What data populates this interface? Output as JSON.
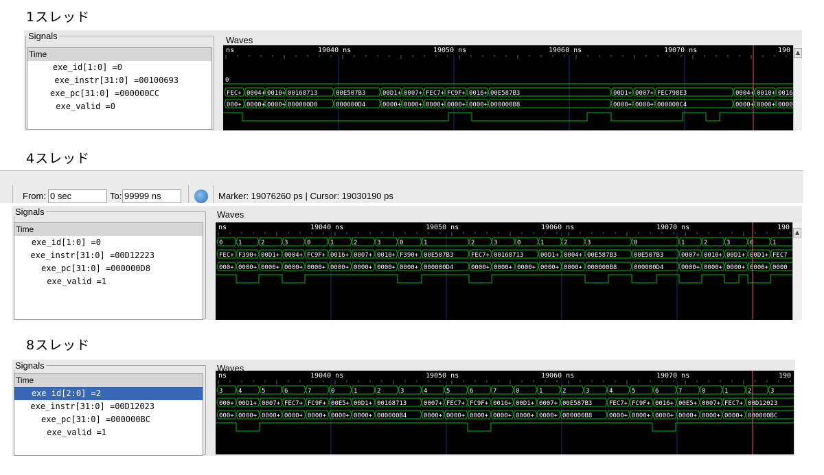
{
  "sections": [
    {
      "title": "1スレッド"
    },
    {
      "title": "4スレッド"
    },
    {
      "title": "8スレッド"
    }
  ],
  "labels": {
    "signals": "Signals",
    "waves": "Waves",
    "time": "Time",
    "ns": "ns"
  },
  "toolbar": {
    "from_label": "From:",
    "from_value": "0 sec",
    "to_label": "To:",
    "to_value": "99999 ns",
    "status": "Marker: 19076260 ps  |  Cursor: 19030190 ps"
  },
  "timeline": {
    "t1": "19040 ns",
    "t2": "19050 ns",
    "t3": "19060 ns",
    "t4": "19070 ns",
    "t5": "190"
  },
  "p1": {
    "signals": [
      "exe_id[1:0] =0",
      "exe_instr[31:0] =00100693",
      "exe_pc[31:0] =000000CC",
      "exe_valid =0"
    ],
    "id_row": "0",
    "instr_row": [
      [
        "FEC+",
        2
      ],
      [
        "0004+",
        31
      ],
      [
        "0010+",
        61
      ],
      [
        "00168713",
        91
      ],
      [
        "00E507B3",
        161
      ],
      [
        "00D1+",
        229
      ],
      [
        "0007+",
        260
      ],
      [
        "FEC7+",
        292
      ],
      [
        "FC9F+",
        323
      ],
      [
        "0016+",
        355
      ],
      [
        "00E587B3",
        386
      ],
      [
        "00D1+",
        565
      ],
      [
        "0007+",
        597
      ],
      [
        "FEC798E3",
        629
      ],
      [
        "0004+",
        743
      ],
      [
        "0010+",
        774
      ],
      [
        "0016",
        805
      ]
    ],
    "pc_row": [
      [
        "000+",
        2
      ],
      [
        "0000+",
        31
      ],
      [
        "0000+",
        61
      ],
      [
        "000000D0",
        91
      ],
      [
        "000000D4",
        161
      ],
      [
        "0000+",
        229
      ],
      [
        "0000+",
        260
      ],
      [
        "0000+",
        292
      ],
      [
        "0000+",
        323
      ],
      [
        "0000+",
        355
      ],
      [
        "000000B8",
        386
      ],
      [
        "0000+",
        565
      ],
      [
        "0000+",
        597
      ],
      [
        "000000C4",
        629
      ],
      [
        "0000+",
        743
      ],
      [
        "0000+",
        774
      ],
      [
        "0000",
        805
      ]
    ]
  },
  "p4": {
    "signals": [
      "exe_id[1:0] =0",
      "exe_instr[31:0] =00D12223",
      "exe_pc[31:0] =000000D8",
      "exe_valid =1"
    ],
    "id_row": [
      [
        "0",
        2
      ],
      [
        "1",
        30
      ],
      [
        "2",
        63
      ],
      [
        "3",
        97
      ],
      [
        "0",
        130
      ],
      [
        "1",
        164
      ],
      [
        "2",
        198
      ],
      [
        "3",
        232
      ],
      [
        "0",
        265
      ],
      [
        "1",
        300
      ],
      [
        "2",
        369
      ],
      [
        "3",
        402
      ],
      [
        "0",
        436
      ],
      [
        "1",
        470
      ],
      [
        "2",
        504
      ],
      [
        "3",
        538
      ],
      [
        "0",
        606
      ],
      [
        "1",
        675
      ],
      [
        "2",
        708
      ],
      [
        "3",
        741
      ],
      [
        "0",
        775
      ],
      [
        "1",
        808
      ]
    ],
    "instr_row": [
      [
        "FEC+",
        2
      ],
      [
        "F390+",
        30
      ],
      [
        "00D1+",
        63
      ],
      [
        "0004+",
        97
      ],
      [
        "FC9F+",
        130
      ],
      [
        "0016+",
        164
      ],
      [
        "0007+",
        198
      ],
      [
        "0010+",
        232
      ],
      [
        "F390+",
        265
      ],
      [
        "00E507B3",
        300
      ],
      [
        "FEC7+",
        369
      ],
      [
        "00168713",
        402
      ],
      [
        "00D1+",
        470
      ],
      [
        "0004+",
        504
      ],
      [
        "00E587B3",
        538
      ],
      [
        "00E507B3",
        606
      ],
      [
        "0007+",
        675
      ],
      [
        "0010+",
        708
      ],
      [
        "00D1+",
        741
      ],
      [
        "00D1+",
        775
      ],
      [
        "FEC7",
        808
      ]
    ],
    "pc_row": [
      [
        "000+",
        2
      ],
      [
        "0000+",
        30
      ],
      [
        "0000+",
        63
      ],
      [
        "0000+",
        97
      ],
      [
        "0000+",
        130
      ],
      [
        "0000+",
        164
      ],
      [
        "0000+",
        198
      ],
      [
        "0000+",
        232
      ],
      [
        "0000+",
        265
      ],
      [
        "000000D4",
        300
      ],
      [
        "0000+",
        369
      ],
      [
        "0000+",
        402
      ],
      [
        "0000+",
        436
      ],
      [
        "0000+",
        470
      ],
      [
        "0000+",
        504
      ],
      [
        "000000B8",
        538
      ],
      [
        "000000D4",
        606
      ],
      [
        "0000+",
        675
      ],
      [
        "0000+",
        708
      ],
      [
        "0000+",
        741
      ],
      [
        "0000+",
        775
      ],
      [
        "0000",
        808
      ]
    ]
  },
  "p8": {
    "signals": [
      "exe id[2:0] =2",
      "exe_instr[31:0] =00D12023",
      "exe_pc[31:0] =000000BC",
      "exe_valid =1"
    ],
    "id_row": [
      [
        "3",
        2
      ],
      [
        "4",
        30
      ],
      [
        "5",
        64
      ],
      [
        "6",
        97
      ],
      [
        "7",
        131
      ],
      [
        "0",
        165
      ],
      [
        "1",
        198
      ],
      [
        "2",
        232
      ],
      [
        "3",
        266
      ],
      [
        "4",
        300
      ],
      [
        "5",
        333
      ],
      [
        "6",
        367
      ],
      [
        "7",
        401
      ],
      [
        "0",
        434
      ],
      [
        "1",
        468
      ],
      [
        "2",
        502
      ],
      [
        "3",
        536
      ],
      [
        "4",
        570
      ],
      [
        "5",
        603
      ],
      [
        "6",
        637
      ],
      [
        "7",
        671
      ],
      [
        "0",
        705
      ],
      [
        "1",
        738
      ],
      [
        "2",
        772
      ],
      [
        "3",
        805
      ]
    ],
    "instr_row": [
      [
        "000+",
        2
      ],
      [
        "00D1+",
        30
      ],
      [
        "0007+",
        64
      ],
      [
        "FEC7+",
        97
      ],
      [
        "FC9F+",
        131
      ],
      [
        "00E5+",
        165
      ],
      [
        "00D1+",
        198
      ],
      [
        "00168713",
        232
      ],
      [
        "0007+",
        300
      ],
      [
        "FEC7+",
        333
      ],
      [
        "FC9F+",
        367
      ],
      [
        "0016+",
        401
      ],
      [
        "00D1+",
        434
      ],
      [
        "0007+",
        468
      ],
      [
        "00E587B3",
        502
      ],
      [
        "FEC7+",
        570
      ],
      [
        "FC9F+",
        603
      ],
      [
        "0016+",
        637
      ],
      [
        "00E5+",
        671
      ],
      [
        "0007+",
        705
      ],
      [
        "FEC7+",
        738
      ],
      [
        "00D12023",
        772
      ]
    ],
    "pc_row": [
      [
        "000+",
        2
      ],
      [
        "0000+",
        30
      ],
      [
        "0000+",
        64
      ],
      [
        "0000+",
        97
      ],
      [
        "0000+",
        131
      ],
      [
        "0000+",
        165
      ],
      [
        "0000+",
        198
      ],
      [
        "000000B4",
        232
      ],
      [
        "0000+",
        300
      ],
      [
        "0000+",
        333
      ],
      [
        "0000+",
        367
      ],
      [
        "0000+",
        401
      ],
      [
        "0000+",
        434
      ],
      [
        "0000+",
        468
      ],
      [
        "000000B8",
        502
      ],
      [
        "0000+",
        570
      ],
      [
        "0000+",
        603
      ],
      [
        "0000+",
        637
      ],
      [
        "0000+",
        671
      ],
      [
        "0000+",
        705
      ],
      [
        "0000+",
        738
      ],
      [
        "000000BC",
        772
      ]
    ]
  }
}
